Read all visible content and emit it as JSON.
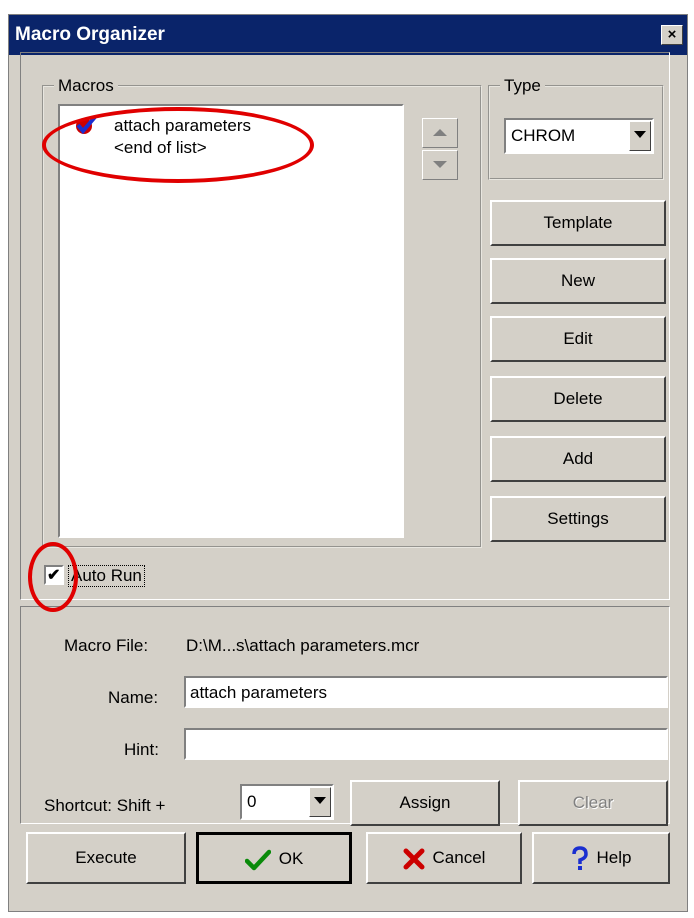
{
  "window": {
    "title": "Macro Organizer",
    "close_glyph": "×"
  },
  "macros": {
    "legend": "Macros",
    "items": [
      {
        "label": "attach parameters",
        "icon": "red-check-badge-icon"
      },
      {
        "label": "<end of list>"
      }
    ]
  },
  "type": {
    "legend": "Type",
    "selected": "CHROM"
  },
  "side_buttons": {
    "template": "Template",
    "new": "New",
    "edit": "Edit",
    "delete": "Delete",
    "add": "Add",
    "settings": "Settings"
  },
  "auto_run": {
    "label": "Auto Run",
    "checked": true
  },
  "details": {
    "macro_file_label": "Macro File:",
    "macro_file_value": "D:\\M...s\\attach parameters.mcr",
    "name_label": "Name:",
    "name_value": "attach parameters",
    "hint_label": "Hint:",
    "hint_value": "",
    "shortcut_label": "Shortcut: Shift +",
    "shortcut_value": "0",
    "assign_label": "Assign",
    "clear_label": "Clear"
  },
  "footer": {
    "execute_label": "Execute",
    "ok_label": "OK",
    "cancel_label": "Cancel",
    "help_label": "Help"
  },
  "colors": {
    "title_bar": "#0a246a",
    "dialog_face": "#d4d0c8",
    "annotation_red": "#e00000"
  }
}
